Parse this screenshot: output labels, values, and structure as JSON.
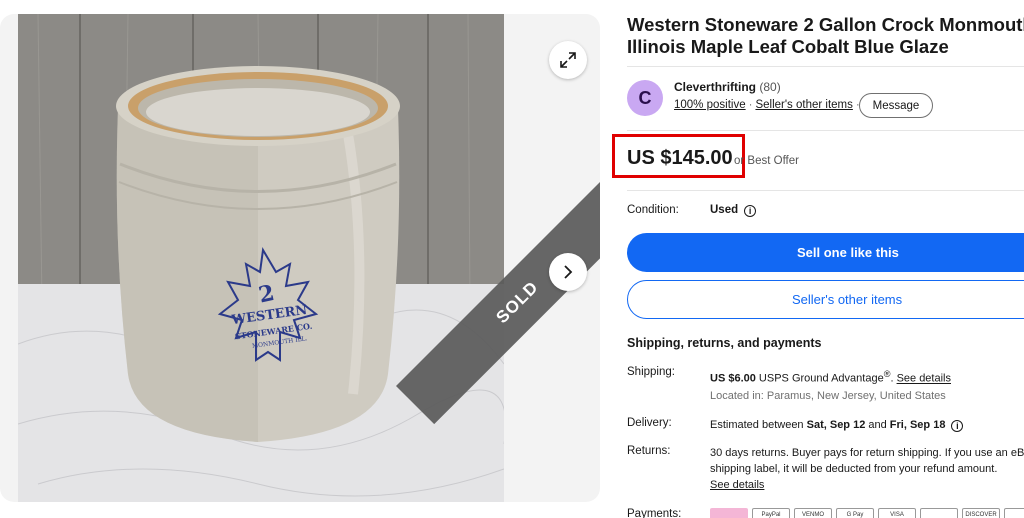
{
  "listing": {
    "title": "Western Stoneware 2 Gallon Crock Monmouth Illinois Maple Leaf Cobalt Blue Glaze",
    "sold_label": "SOLD"
  },
  "seller": {
    "avatar_letter": "C",
    "name": "Cleverthrifting",
    "feedback_count": "(80)",
    "positive": "100% positive",
    "separator": "·",
    "other_items": "Seller's other items",
    "message_button": "Message"
  },
  "price": {
    "amount": "US $145.00",
    "best_offer": "or Best Offer"
  },
  "condition": {
    "label": "Condition:",
    "value": "Used",
    "info_glyph": "i"
  },
  "buttons": {
    "sell_one": "Sell one like this",
    "sellers_other_items": "Seller's other items"
  },
  "shipping": {
    "heading": "Shipping, returns, and payments",
    "shipping_label": "Shipping:",
    "shipping_price": "US $6.00",
    "shipping_method": " USPS Ground Advantage",
    "shipping_reg": "®",
    "shipping_sep": ". ",
    "see_details": "See details",
    "located": "Located in: Paramus, New Jersey, United States",
    "delivery_label": "Delivery:",
    "delivery_prefix": "Estimated between ",
    "delivery_start": "Sat, Sep 12",
    "delivery_and": " and ",
    "delivery_end": "Fri, Sep 18",
    "returns_label": "Returns:",
    "returns_text": "30 days returns. Buyer pays for return shipping. If you use an eBay shipping label, it will be deducted from your refund amount.",
    "returns_details": "See details",
    "payments_label": "Payments:"
  },
  "payments": [
    "",
    "PayPal",
    "VENMO",
    "G Pay",
    "VISA",
    "",
    "DISCOVER",
    ""
  ],
  "colors": {
    "accent": "#1268f3",
    "price_highlight": "#e00000",
    "avatar_bg": "#c9a8f2"
  },
  "icons": {
    "expand": "expand-icon",
    "next": "chevron-right-icon",
    "info": "info-icon"
  }
}
